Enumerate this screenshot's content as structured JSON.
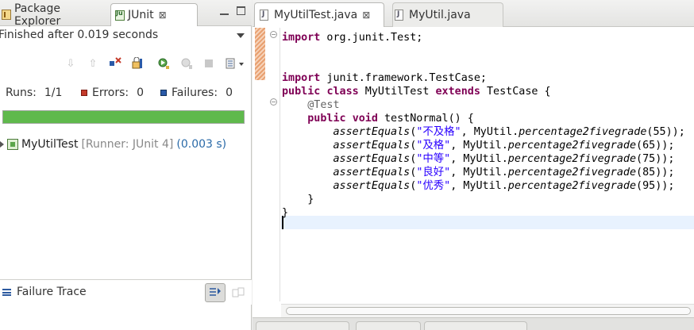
{
  "left_view": {
    "tabs": [
      {
        "label": "Package Explorer",
        "icon": "package-icon"
      },
      {
        "label": "JUnit",
        "icon": "junit-icon"
      }
    ],
    "close_glyph": "⊠",
    "status": "Finished after 0.019 seconds",
    "counters": {
      "runs_label": "Runs:",
      "runs_value": "1/1",
      "errors_label": "Errors:",
      "errors_value": "0",
      "failures_label": "Failures:",
      "failures_value": "0"
    },
    "progress": {
      "fraction": 1.0,
      "color": "#5fb94c"
    },
    "tree": {
      "name": "MyUtilTest",
      "runner": "[Runner: JUnit 4]",
      "time": "(0.003 s)"
    },
    "failure_trace": {
      "title": "Failure Trace"
    }
  },
  "editor": {
    "tabs": [
      {
        "label": "MyUtilTest.java",
        "active": true
      },
      {
        "label": "MyUtil.java",
        "active": false
      }
    ],
    "close_glyph": "⊠",
    "lines": [
      [
        {
          "t": "import",
          "c": "kw"
        },
        {
          "t": " org.junit.Test;",
          "c": ""
        }
      ],
      [],
      [],
      [
        {
          "t": "import",
          "c": "kw"
        },
        {
          "t": " junit.framework.TestCase;",
          "c": ""
        }
      ],
      [
        {
          "t": "public",
          "c": "kw"
        },
        {
          "t": " ",
          "c": ""
        },
        {
          "t": "class",
          "c": "kw"
        },
        {
          "t": " MyUtilTest ",
          "c": ""
        },
        {
          "t": "extends",
          "c": "kw"
        },
        {
          "t": " TestCase {",
          "c": ""
        }
      ],
      [
        {
          "t": "    @Test",
          "c": "ann"
        }
      ],
      [
        {
          "t": "    ",
          "c": ""
        },
        {
          "t": "public",
          "c": "kw"
        },
        {
          "t": " ",
          "c": ""
        },
        {
          "t": "void",
          "c": "kw"
        },
        {
          "t": " testNormal() {",
          "c": ""
        }
      ],
      [
        {
          "t": "        ",
          "c": ""
        },
        {
          "t": "assertEquals",
          "c": "it"
        },
        {
          "t": "(",
          "c": ""
        },
        {
          "t": "\"不及格\"",
          "c": "str"
        },
        {
          "t": ", MyUtil.",
          "c": ""
        },
        {
          "t": "percentage2fivegrade",
          "c": "it"
        },
        {
          "t": "(55));",
          "c": ""
        }
      ],
      [
        {
          "t": "        ",
          "c": ""
        },
        {
          "t": "assertEquals",
          "c": "it"
        },
        {
          "t": "(",
          "c": ""
        },
        {
          "t": "\"及格\"",
          "c": "str"
        },
        {
          "t": ", MyUtil.",
          "c": ""
        },
        {
          "t": "percentage2fivegrade",
          "c": "it"
        },
        {
          "t": "(65));",
          "c": ""
        }
      ],
      [
        {
          "t": "        ",
          "c": ""
        },
        {
          "t": "assertEquals",
          "c": "it"
        },
        {
          "t": "(",
          "c": ""
        },
        {
          "t": "\"中等\"",
          "c": "str"
        },
        {
          "t": ", MyUtil.",
          "c": ""
        },
        {
          "t": "percentage2fivegrade",
          "c": "it"
        },
        {
          "t": "(75));",
          "c": ""
        }
      ],
      [
        {
          "t": "        ",
          "c": ""
        },
        {
          "t": "assertEquals",
          "c": "it"
        },
        {
          "t": "(",
          "c": ""
        },
        {
          "t": "\"良好\"",
          "c": "str"
        },
        {
          "t": ", MyUtil.",
          "c": ""
        },
        {
          "t": "percentage2fivegrade",
          "c": "it"
        },
        {
          "t": "(85));",
          "c": ""
        }
      ],
      [
        {
          "t": "        ",
          "c": ""
        },
        {
          "t": "assertEquals",
          "c": "it"
        },
        {
          "t": "(",
          "c": ""
        },
        {
          "t": "\"优秀\"",
          "c": "str"
        },
        {
          "t": ", MyUtil.",
          "c": ""
        },
        {
          "t": "percentage2fivegrade",
          "c": "it"
        },
        {
          "t": "(95));",
          "c": ""
        }
      ],
      [
        {
          "t": "    }",
          "c": ""
        }
      ],
      [
        {
          "t": "}",
          "c": ""
        }
      ],
      []
    ]
  }
}
